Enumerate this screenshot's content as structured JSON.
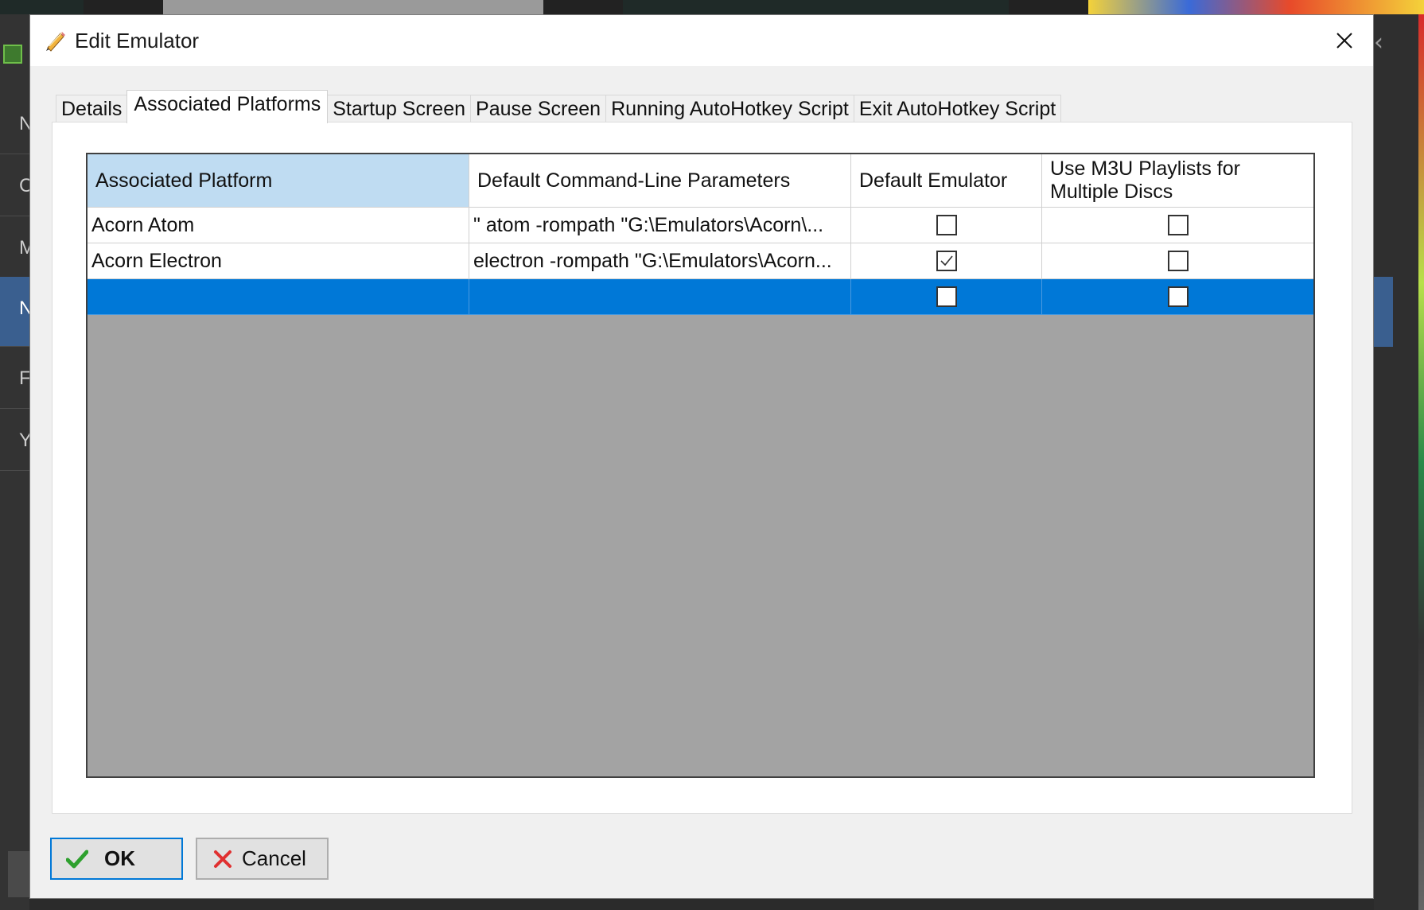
{
  "window": {
    "title": "Edit Emulator",
    "title_icon": "pencil-icon",
    "close_icon": "close-icon"
  },
  "background": {
    "sidebar_letters": [
      "N",
      "C",
      "M",
      "N",
      "F",
      "Y"
    ]
  },
  "tabs": [
    {
      "label": "Details",
      "active": false
    },
    {
      "label": "Associated Platforms",
      "active": true
    },
    {
      "label": "Startup Screen",
      "active": false
    },
    {
      "label": "Pause Screen",
      "active": false
    },
    {
      "label": "Running AutoHotkey Script",
      "active": false
    },
    {
      "label": "Exit AutoHotkey Script",
      "active": false
    }
  ],
  "grid": {
    "columns": [
      "Associated Platform",
      "Default Command-Line Parameters",
      "Default Emulator",
      "Use M3U Playlists for Multiple Discs"
    ],
    "rows": [
      {
        "platform": "Acorn Atom",
        "params": "\" atom -rompath \"G:\\Emulators\\Acorn\\...",
        "default_emulator": false,
        "use_m3u": false,
        "selected": false
      },
      {
        "platform": "Acorn Electron",
        "params": "electron -rompath \"G:\\Emulators\\Acorn...",
        "default_emulator": true,
        "use_m3u": false,
        "selected": false
      },
      {
        "platform": "",
        "params": "",
        "default_emulator": false,
        "use_m3u": false,
        "selected": true
      }
    ]
  },
  "buttons": {
    "ok_label": "OK",
    "ok_icon": "checkmark-icon",
    "cancel_label": "Cancel",
    "cancel_icon": "red-x-icon"
  },
  "colors": {
    "selection": "#0078d7",
    "sorted_header": "#bfdcf2",
    "grid_empty_area": "#a3a3a3"
  }
}
